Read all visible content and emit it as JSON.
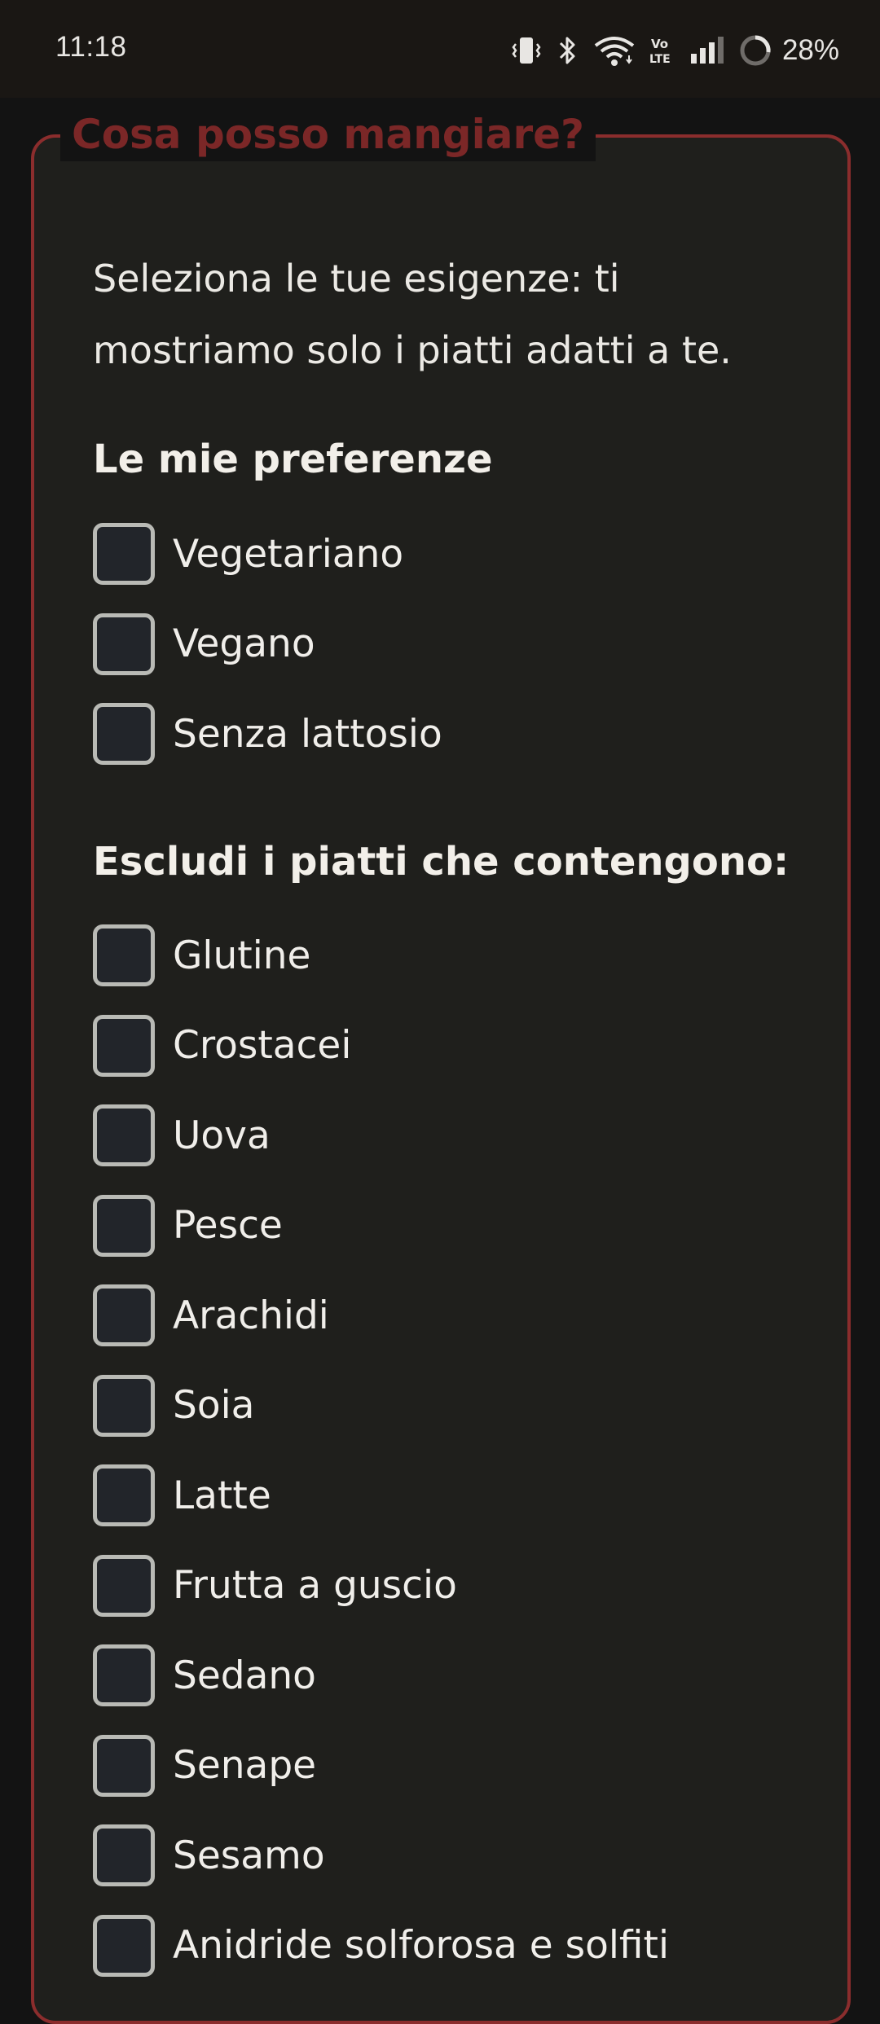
{
  "status_bar": {
    "time": "11:18",
    "icons": [
      "vibrate-icon",
      "bluetooth-icon",
      "wifi-icon",
      "volte-icon",
      "signal-icon",
      "battery-ring-icon"
    ],
    "battery": "28%"
  },
  "form": {
    "legend": "Cosa posso mangiare?",
    "intro": "Seleziona le tue esigenze: ti mostriamo solo i piatti adatti a te.",
    "preferences_title": "Le mie preferenze",
    "preferences": [
      {
        "label": "Vegetariano",
        "checked": false
      },
      {
        "label": "Vegano",
        "checked": false
      },
      {
        "label": "Senza lattosio",
        "checked": false
      }
    ],
    "exclude_title": "Escludi i piatti che contengono:",
    "allergens": [
      {
        "label": "Glutine",
        "checked": false
      },
      {
        "label": "Crostacei",
        "checked": false
      },
      {
        "label": "Uova",
        "checked": false
      },
      {
        "label": "Pesce",
        "checked": false
      },
      {
        "label": "Arachidi",
        "checked": false
      },
      {
        "label": "Soia",
        "checked": false
      },
      {
        "label": "Latte",
        "checked": false
      },
      {
        "label": "Frutta a guscio",
        "checked": false
      },
      {
        "label": "Sedano",
        "checked": false
      },
      {
        "label": "Senape",
        "checked": false
      },
      {
        "label": "Sesamo",
        "checked": false
      },
      {
        "label": "Anidride solforosa e solfiti",
        "checked": false
      }
    ]
  },
  "colors": {
    "accent": "#8b2d2d",
    "legend_text": "#7b2727",
    "panel_bg": "#1f1f1c",
    "page_bg": "#131313"
  }
}
